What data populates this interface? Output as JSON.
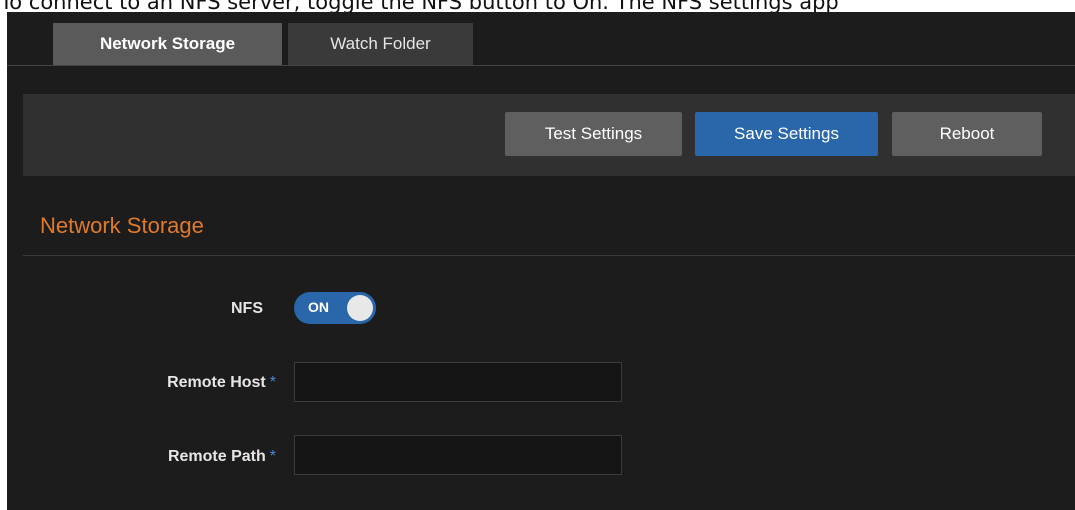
{
  "doc_text": "To connect to an NFS server, toggle the NFS button to On. The NFS settings app",
  "tabs": [
    {
      "label": "Network Storage",
      "active": true
    },
    {
      "label": "Watch Folder",
      "active": false
    }
  ],
  "toolbar": {
    "test_label": "Test Settings",
    "save_label": "Save Settings",
    "reboot_label": "Reboot"
  },
  "section": {
    "title": "Network Storage"
  },
  "form": {
    "nfs_label": "NFS",
    "nfs_toggle_text": "ON",
    "nfs_enabled": true,
    "remote_host_label": "Remote Host",
    "remote_host_value": "",
    "remote_path_label": "Remote Path",
    "remote_path_value": "",
    "required_mark": "*"
  },
  "colors": {
    "accent_blue": "#2a67aa",
    "section_title": "#e07a2b",
    "background": "#1c1c1c"
  }
}
